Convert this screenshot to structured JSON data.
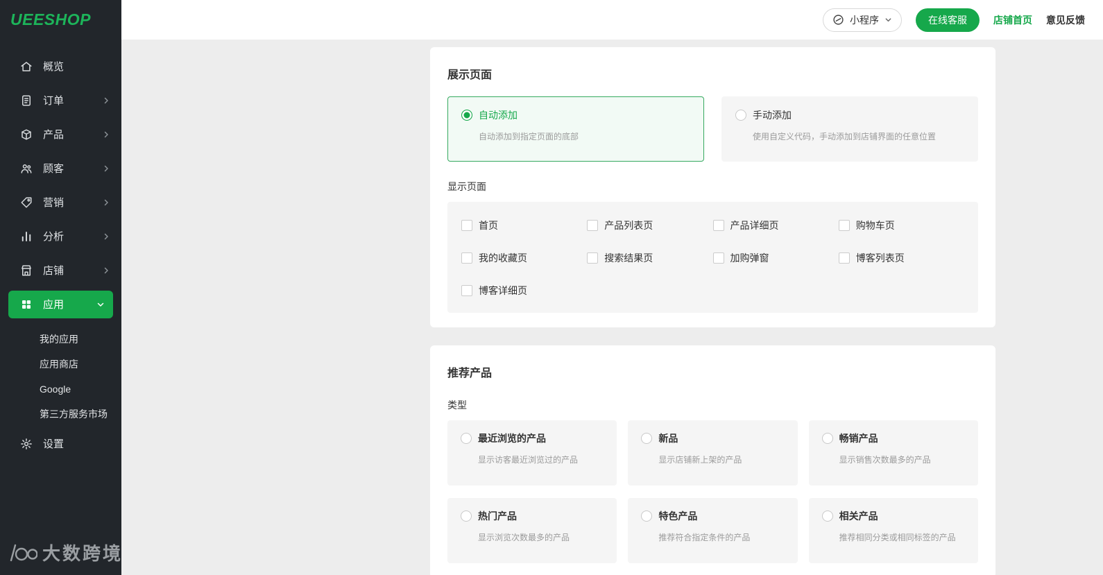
{
  "brand": {
    "logo_text": "UEESHOP"
  },
  "header": {
    "miniprogram_label": "小程序",
    "customer_service_label": "在线客服",
    "store_home_label": "店铺首页",
    "feedback_label": "意见反馈"
  },
  "sidebar": {
    "items": [
      {
        "label": "概览"
      },
      {
        "label": "订单"
      },
      {
        "label": "产品"
      },
      {
        "label": "顾客"
      },
      {
        "label": "营销"
      },
      {
        "label": "分析"
      },
      {
        "label": "店铺"
      },
      {
        "label": "应用"
      }
    ],
    "submenu": [
      "我的应用",
      "应用商店",
      "Google",
      "第三方服务市场"
    ],
    "settings_label": "设置"
  },
  "display_section": {
    "title": "展示页面",
    "options": [
      {
        "label": "自动添加",
        "desc": "自动添加到指定页面的底部",
        "selected": true
      },
      {
        "label": "手动添加",
        "desc": "使用自定义代码，手动添加到店铺界面的任意位置",
        "selected": false
      }
    ],
    "pages_label": "显示页面",
    "pages": [
      "首页",
      "产品列表页",
      "产品详细页",
      "购物车页",
      "我的收藏页",
      "搜索结果页",
      "加购弹窗",
      "博客列表页",
      "博客详细页"
    ]
  },
  "recommend_section": {
    "title": "推荐产品",
    "type_label": "类型",
    "options": [
      {
        "label": "最近浏览的产品",
        "desc": "显示访客最近浏览过的产品"
      },
      {
        "label": "新品",
        "desc": "显示店铺新上架的产品"
      },
      {
        "label": "畅销产品",
        "desc": "显示销售次数最多的产品"
      },
      {
        "label": "热门产品",
        "desc": "显示浏览次数最多的产品"
      },
      {
        "label": "特色产品",
        "desc": "推荐符合指定条件的产品"
      },
      {
        "label": "相关产品",
        "desc": "推荐相同分类或相同标签的产品"
      }
    ]
  },
  "watermark": {
    "text": "大数跨境"
  },
  "colors": {
    "accent_green": "#16a84b",
    "sidebar_bg": "#22262b",
    "selected_card_border": "#35a95f",
    "selected_card_bg": "#f2faf5",
    "panel_bg": "#f5f5f5"
  }
}
